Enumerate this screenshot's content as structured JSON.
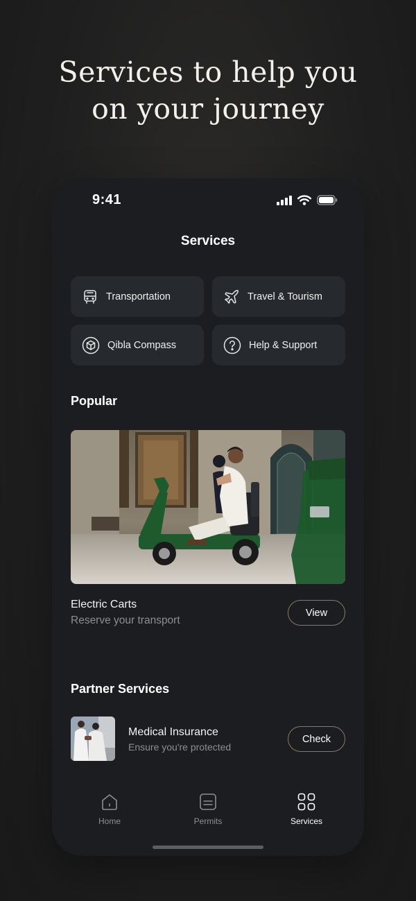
{
  "headline": {
    "line1": "Services to help you",
    "line2": "on your journey"
  },
  "status_bar": {
    "time": "9:41",
    "icons": [
      "signal-icon",
      "wifi-icon",
      "battery-icon"
    ]
  },
  "screen": {
    "title": "Services"
  },
  "services": [
    {
      "label": "Transportation",
      "icon": "bus-icon"
    },
    {
      "label": "Travel & Tourism",
      "icon": "airplane-icon"
    },
    {
      "label": "Qibla Compass",
      "icon": "kaaba-compass-icon"
    },
    {
      "label": "Help & Support",
      "icon": "question-icon"
    }
  ],
  "popular": {
    "section_title": "Popular",
    "card": {
      "title": "Electric Carts",
      "subtitle": "Reserve your transport",
      "button_label": "View"
    }
  },
  "partner": {
    "section_title": "Partner Services",
    "item": {
      "title": "Medical Insurance",
      "subtitle": "Ensure you're protected",
      "button_label": "Check"
    }
  },
  "tabbar": {
    "tabs": [
      {
        "label": "Home",
        "icon": "home-icon",
        "active": false
      },
      {
        "label": "Permits",
        "icon": "permits-icon",
        "active": false
      },
      {
        "label": "Services",
        "icon": "grid-icon",
        "active": true
      }
    ]
  },
  "colors": {
    "background": "#1f1f1f",
    "phone_surface": "#1b1d20",
    "tile": "#26292d",
    "button_border": "#8d7a56",
    "muted_text": "#8b8f94",
    "cart_green": "#1f5a2e"
  }
}
